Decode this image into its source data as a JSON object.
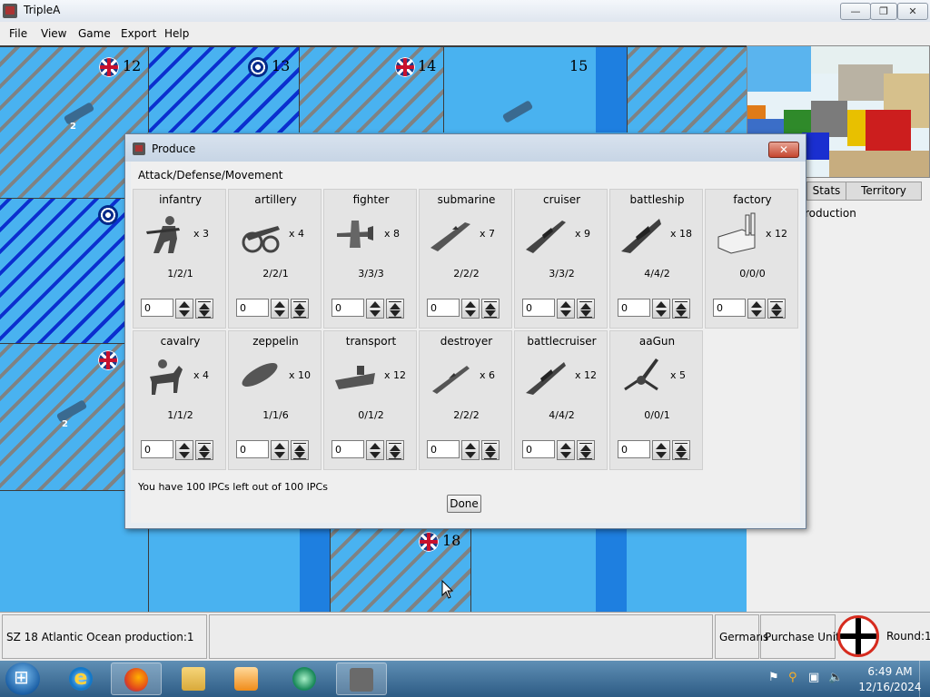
{
  "window": {
    "title": "TripleA",
    "min_glyph": "—",
    "max_glyph": "❐",
    "close_glyph": "✕"
  },
  "menu": [
    "File",
    "View",
    "Game",
    "Export",
    "Help"
  ],
  "map": {
    "zone_labels": [
      "12",
      "13",
      "14",
      "15",
      "18"
    ],
    "ship_counts": [
      "2",
      "2"
    ],
    "colors": {
      "sea": "#49b2f0",
      "channel": "#1e7fe0",
      "hatch_grey": "#7f8283",
      "hatch_blue": "#0b2fcf"
    }
  },
  "right_panel": {
    "tabs": [
      "Stats",
      "Territory"
    ],
    "text": "roduction"
  },
  "dialog": {
    "title": "Produce",
    "close_glyph": "✕",
    "subtitle": "Attack/Defense/Movement",
    "units": [
      {
        "name": "infantry",
        "cost": "x 3",
        "stats": "1/2/1",
        "qty": "0",
        "icon": "infantry-icon"
      },
      {
        "name": "artillery",
        "cost": "x 4",
        "stats": "2/2/1",
        "qty": "0",
        "icon": "artillery-icon"
      },
      {
        "name": "fighter",
        "cost": "x 8",
        "stats": "3/3/3",
        "qty": "0",
        "icon": "fighter-icon"
      },
      {
        "name": "submarine",
        "cost": "x 7",
        "stats": "2/2/2",
        "qty": "0",
        "icon": "submarine-icon"
      },
      {
        "name": "cruiser",
        "cost": "x 9",
        "stats": "3/3/2",
        "qty": "0",
        "icon": "cruiser-icon"
      },
      {
        "name": "battleship",
        "cost": "x 18",
        "stats": "4/4/2",
        "qty": "0",
        "icon": "battleship-icon"
      },
      {
        "name": "factory",
        "cost": "x 12",
        "stats": "0/0/0",
        "qty": "0",
        "icon": "factory-icon"
      },
      {
        "name": "cavalry",
        "cost": "x 4",
        "stats": "1/1/2",
        "qty": "0",
        "icon": "cavalry-icon"
      },
      {
        "name": "zeppelin",
        "cost": "x 10",
        "stats": "1/1/6",
        "qty": "0",
        "icon": "zeppelin-icon"
      },
      {
        "name": "transport",
        "cost": "x 12",
        "stats": "0/1/2",
        "qty": "0",
        "icon": "transport-icon"
      },
      {
        "name": "destroyer",
        "cost": "x 6",
        "stats": "2/2/2",
        "qty": "0",
        "icon": "destroyer-icon"
      },
      {
        "name": "battlecruiser",
        "cost": "x 12",
        "stats": "4/4/2",
        "qty": "0",
        "icon": "battlecruiser-icon"
      },
      {
        "name": "aaGun",
        "cost": "x 5",
        "stats": "0/0/1",
        "qty": "0",
        "icon": "aagun-icon"
      }
    ],
    "ipc_text": "You have 100 IPCs left out of 100 IPCs",
    "done_label": "Done"
  },
  "status": {
    "territory": "SZ 18 Atlantic Ocean production:1",
    "player": "Germans",
    "step": "Purchase Units",
    "round": "Round:1"
  },
  "taskbar": {
    "apps": [
      "start-orb",
      "internet-explorer-icon",
      "firefox-icon",
      "file-explorer-icon",
      "media-player-icon",
      "media-center-icon",
      "triplea-icon"
    ],
    "time": "6:49 AM",
    "date": "12/16/2024"
  }
}
